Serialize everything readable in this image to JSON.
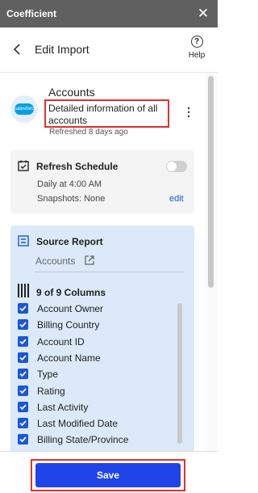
{
  "titlebar": {
    "app_name": "Coefficient",
    "close_glyph": "✕"
  },
  "header": {
    "title": "Edit Import",
    "help_label": "Help",
    "help_glyph": "?"
  },
  "account": {
    "name": "Accounts",
    "description": "Detailed information of all accounts",
    "refreshed": "Refreshed 8 days ago",
    "logo_text": "salesforce",
    "more_glyph": "⋮"
  },
  "refresh_schedule": {
    "title": "Refresh Schedule",
    "schedule": "Daily at 4:00 AM",
    "snapshots": "Snapshots: None",
    "edit_label": "edit",
    "enabled": false
  },
  "source_report": {
    "title": "Source Report",
    "report_name": "Accounts"
  },
  "columns": {
    "summary": "9 of 9 Columns",
    "items": [
      {
        "label": "Account Owner",
        "checked": true
      },
      {
        "label": "Billing Country",
        "checked": true
      },
      {
        "label": "Account ID",
        "checked": true
      },
      {
        "label": "Account Name",
        "checked": true
      },
      {
        "label": "Type",
        "checked": true
      },
      {
        "label": "Rating",
        "checked": true
      },
      {
        "label": "Last Activity",
        "checked": true
      },
      {
        "label": "Last Modified Date",
        "checked": true
      },
      {
        "label": "Billing State/Province",
        "checked": true
      }
    ]
  },
  "footer": {
    "save_label": "Save"
  },
  "colors": {
    "titlebar": "#606060",
    "accent": "#1f44e8",
    "checkbox": "#1a56db",
    "highlight": "#e0312b",
    "card_blue": "#dbe9f9"
  }
}
